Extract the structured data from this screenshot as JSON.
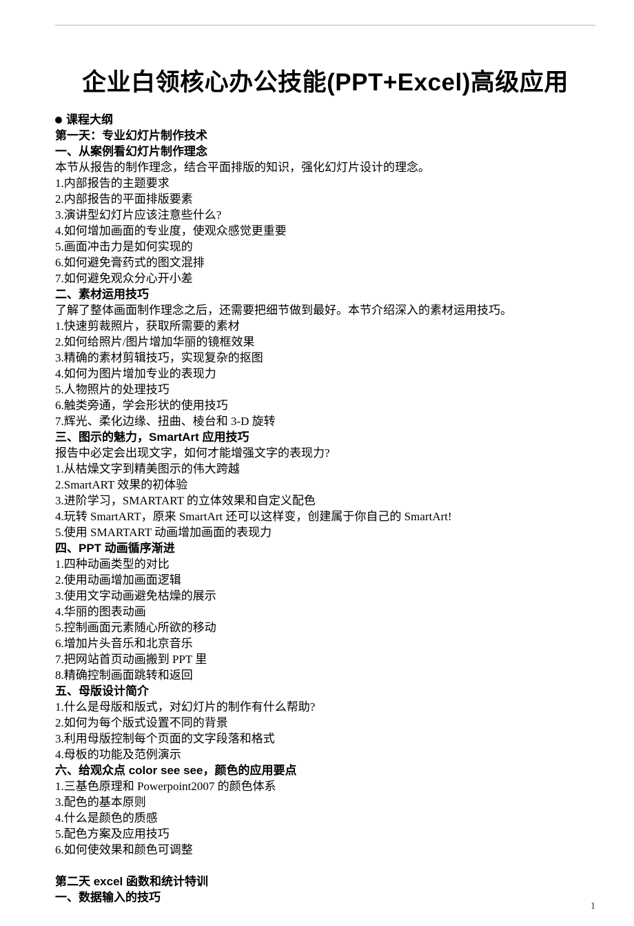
{
  "title": "企业白领核心办公技能(PPT+Excel)高级应用",
  "outline_label": "课程大纲",
  "day1_heading": "第一天：专业幻灯片制作技术",
  "day2_heading": "第二天 excel 函数和统计特训",
  "sections": [
    {
      "heading": "一、从案例看幻灯片制作理念",
      "intro": "本节从报告的制作理念，结合平面排版的知识，强化幻灯片设计的理念。",
      "items": [
        "1.内部报告的主题要求",
        "2.内部报告的平面排版要素",
        "3.演讲型幻灯片应该注意些什么?",
        "4.如何增加画面的专业度，使观众感觉更重要",
        "5.画面冲击力是如何实现的",
        "6.如何避免膏药式的图文混排",
        "7.如何避免观众分心开小差"
      ]
    },
    {
      "heading": "二、素材运用技巧",
      "intro": "了解了整体画面制作理念之后，还需要把细节做到最好。本节介绍深入的素材运用技巧。",
      "items": [
        "1.快速剪裁照片，获取所需要的素材",
        "2.如何给照片/图片增加华丽的镜框效果",
        "3.精确的素材剪辑技巧，实现复杂的抠图",
        "4.如何为图片增加专业的表现力",
        "5.人物照片的处理技巧",
        "6.触类旁通，学会形状的使用技巧",
        "7.辉光、柔化边缘、扭曲、棱台和 3-D 旋转"
      ]
    },
    {
      "heading": "三、图示的魅力，SmartArt 应用技巧",
      "intro": "报告中必定会出现文字，如何才能增强文字的表现力?",
      "items": [
        "1.从枯燥文字到精美图示的伟大跨越",
        "2.SmartART 效果的初体验",
        "3.进阶学习，SMARTART 的立体效果和自定义配色",
        "4.玩转 SmartART，原来 SmartArt 还可以这样变，创建属于你自己的 SmartArt!",
        "5.使用 SMARTART 动画增加画面的表现力"
      ]
    },
    {
      "heading": "四、PPT 动画循序渐进",
      "intro": "",
      "items": [
        "1.四种动画类型的对比",
        "2.使用动画增加画面逻辑",
        "3.使用文字动画避免枯燥的展示",
        "4.华丽的图表动画",
        "5.控制画面元素随心所欲的移动",
        "6.增加片头音乐和北京音乐",
        "7.把网站首页动画搬到 PPT 里",
        "8.精确控制画面跳转和返回"
      ]
    },
    {
      "heading": "五、母版设计简介",
      "intro": "",
      "items": [
        "1.什么是母版和版式，对幻灯片的制作有什么帮助?",
        "2.如何为每个版式设置不同的背景",
        "3.利用母版控制每个页面的文字段落和格式",
        "4.母板的功能及范例演示"
      ]
    },
    {
      "heading": "六、给观众点 color see see，颜色的应用要点",
      "intro": "",
      "items": [
        "1.三基色原理和 Powerpoint2007 的颜色体系",
        "3.配色的基本原则",
        "4.什么是颜色的质感",
        "5.配色方案及应用技巧",
        "6.如何使效果和颜色可调整"
      ]
    }
  ],
  "day2_first_section": "一、数据输入的技巧",
  "page_number": "1"
}
